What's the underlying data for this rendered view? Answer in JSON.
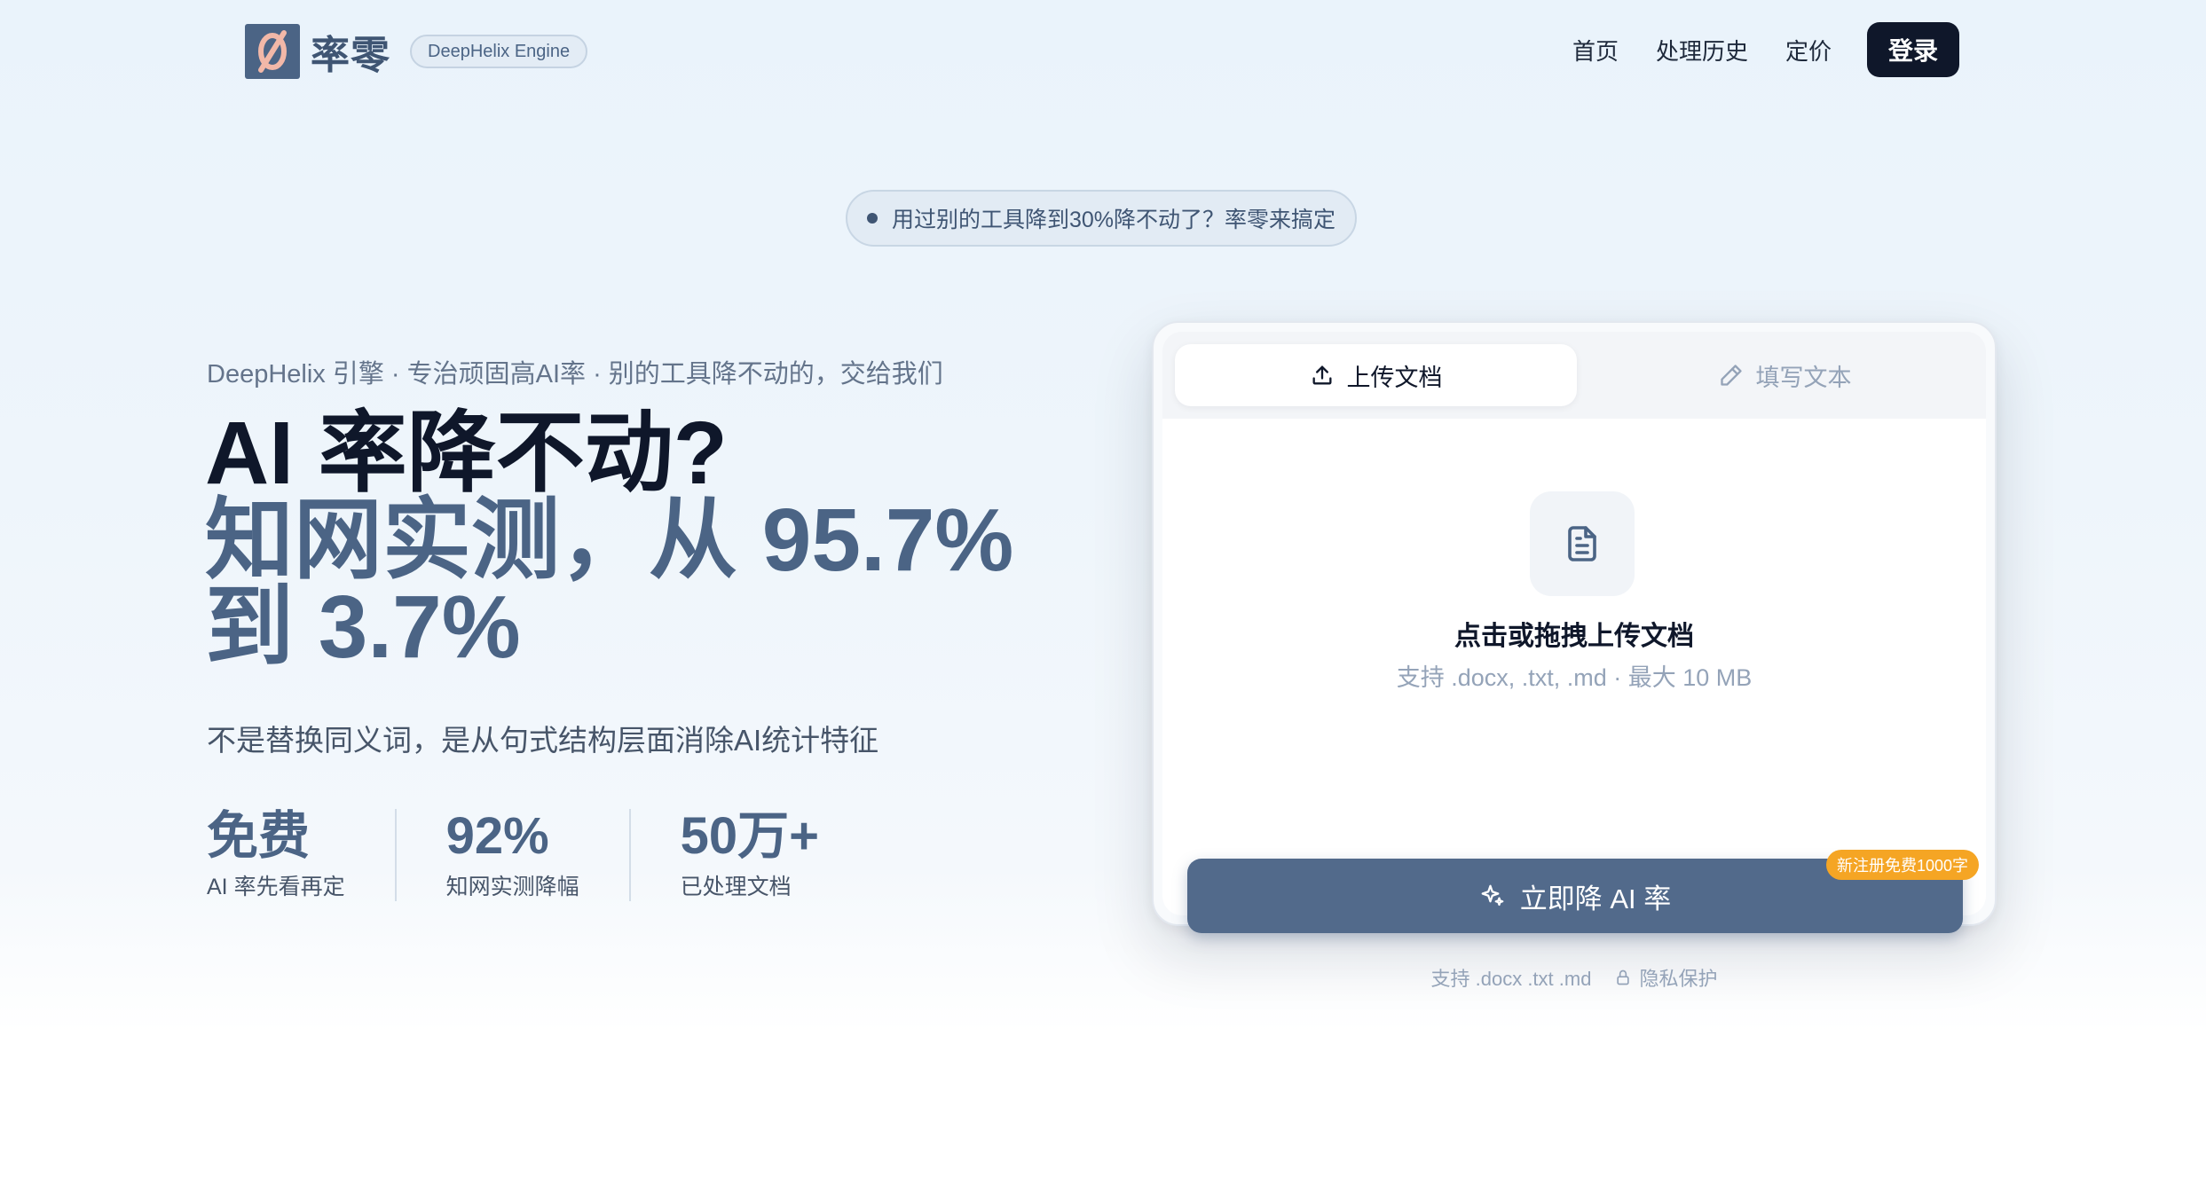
{
  "header": {
    "logo_text": "率零",
    "engine_badge": "DeepHelix Engine",
    "nav": [
      "首页",
      "处理历史",
      "定价"
    ],
    "login_label": "登录"
  },
  "announcement": "用过别的工具降到30%降不动了？率零来搞定",
  "hero": {
    "tagline": "DeepHelix 引擎 · 专治顽固高AI率 · 别的工具降不动的，交给我们",
    "headline_line1": "AI 率降不动?",
    "headline_line2": "知网实测，从 95.7%",
    "headline_line3": "到 3.7%",
    "subline": "不是替换同义词，是从句式结构层面消除AI统计特征",
    "stats": [
      {
        "value": "免费",
        "label": "AI 率先看再定"
      },
      {
        "value": "92%",
        "label": "知网实测降幅"
      },
      {
        "value": "50万+",
        "label": "已处理文档"
      }
    ]
  },
  "upload_card": {
    "tabs": [
      {
        "label": "上传文档",
        "icon": "upload-icon"
      },
      {
        "label": "填写文本",
        "icon": "pencil-icon"
      }
    ],
    "drop_title": "点击或拖拽上传文档",
    "drop_hint": "支持 .docx, .txt, .md · 最大 10 MB",
    "cta_label": "立即降 AI 率",
    "cta_badge": "新注册免费1000字",
    "footer_formats": "支持 .docx .txt .md",
    "footer_privacy": "隐私保护"
  },
  "colors": {
    "brand": "#4b6485",
    "dark": "#0f172a",
    "cta": "#526a8b",
    "badge": "#f5a524",
    "logo_accent": "#f2b8a8"
  }
}
